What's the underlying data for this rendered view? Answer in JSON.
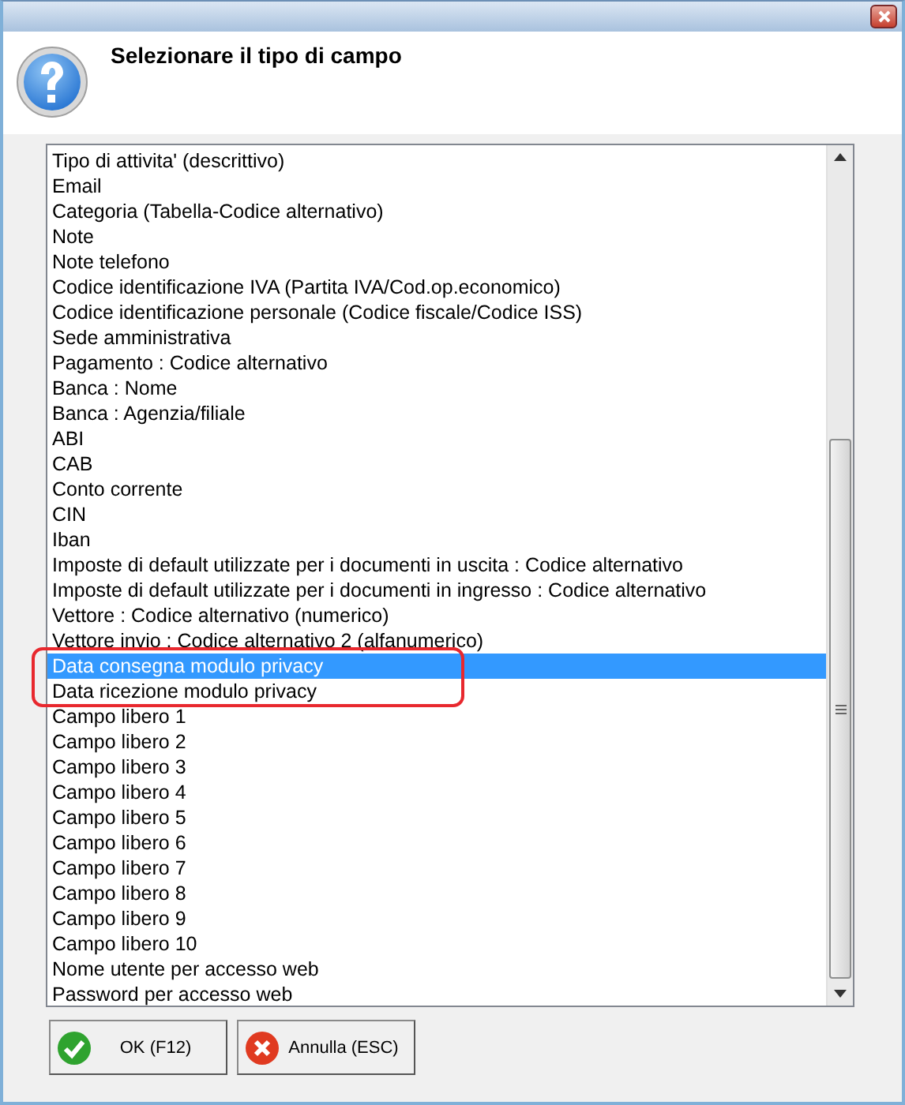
{
  "header": {
    "title": "Selezionare il tipo di campo"
  },
  "list": {
    "items": [
      {
        "label": "Tipo di attivita' (descrittivo)",
        "selected": false
      },
      {
        "label": "Email",
        "selected": false
      },
      {
        "label": "Categoria (Tabella-Codice alternativo)",
        "selected": false
      },
      {
        "label": "Note",
        "selected": false
      },
      {
        "label": "Note telefono",
        "selected": false
      },
      {
        "label": "Codice identificazione IVA (Partita IVA/Cod.op.economico)",
        "selected": false
      },
      {
        "label": "Codice identificazione personale (Codice fiscale/Codice ISS)",
        "selected": false
      },
      {
        "label": "Sede amministrativa",
        "selected": false
      },
      {
        "label": "Pagamento : Codice alternativo",
        "selected": false
      },
      {
        "label": "Banca : Nome",
        "selected": false
      },
      {
        "label": "Banca : Agenzia/filiale",
        "selected": false
      },
      {
        "label": "ABI",
        "selected": false
      },
      {
        "label": "CAB",
        "selected": false
      },
      {
        "label": "Conto corrente",
        "selected": false
      },
      {
        "label": "CIN",
        "selected": false
      },
      {
        "label": "Iban",
        "selected": false
      },
      {
        "label": "Imposte di default utilizzate per i documenti in uscita : Codice alternativo",
        "selected": false
      },
      {
        "label": "Imposte di default utilizzate per i documenti in ingresso : Codice alternativo",
        "selected": false
      },
      {
        "label": "Vettore : Codice alternativo (numerico)",
        "selected": false
      },
      {
        "label": "Vettore invio : Codice alternativo 2 (alfanumerico)",
        "selected": false
      },
      {
        "label": "Data consegna modulo privacy",
        "selected": true
      },
      {
        "label": "Data ricezione modulo privacy",
        "selected": false
      },
      {
        "label": "Campo libero 1",
        "selected": false
      },
      {
        "label": "Campo libero 2",
        "selected": false
      },
      {
        "label": "Campo libero 3",
        "selected": false
      },
      {
        "label": "Campo libero 4",
        "selected": false
      },
      {
        "label": "Campo libero 5",
        "selected": false
      },
      {
        "label": "Campo libero 6",
        "selected": false
      },
      {
        "label": "Campo libero 7",
        "selected": false
      },
      {
        "label": "Campo libero 8",
        "selected": false
      },
      {
        "label": "Campo libero 9",
        "selected": false
      },
      {
        "label": "Campo libero 10",
        "selected": false
      },
      {
        "label": "Nome utente per accesso web",
        "selected": false
      },
      {
        "label": "Password per accesso web",
        "selected": false
      }
    ]
  },
  "buttons": [
    {
      "label": "OK (F12)",
      "kind": "ok"
    },
    {
      "label": "Annulla (ESC)",
      "kind": "cancel"
    }
  ]
}
